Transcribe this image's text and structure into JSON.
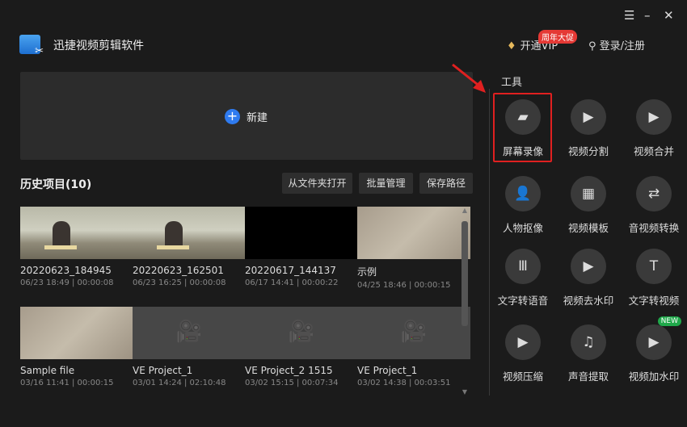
{
  "window": {
    "menu_icon": "☰",
    "min_icon": "–",
    "close_icon": "✕"
  },
  "app": {
    "title": "迅捷视频剪辑软件"
  },
  "header": {
    "vip_label": "开通VIP",
    "promo_badge": "周年大促",
    "login_label": "登录/注册"
  },
  "new_project": {
    "label": "新建",
    "icon": "+"
  },
  "history": {
    "title": "历史项目(10)",
    "buttons": [
      "从文件夹打开",
      "批量管理",
      "保存路径"
    ],
    "items": [
      {
        "name": "20220623_184945",
        "meta": "06/23 18:49 | 00:00:08",
        "thumb": "beach"
      },
      {
        "name": "20220623_162501",
        "meta": "06/23 16:25 | 00:00:08",
        "thumb": "beach"
      },
      {
        "name": "20220617_144137",
        "meta": "06/17 14:41 | 00:00:22",
        "thumb": "black"
      },
      {
        "name": "示例",
        "meta": "04/25 18:46 | 00:00:15",
        "thumb": "sand"
      },
      {
        "name": "Sample file",
        "meta": "03/16 11:41 | 00:00:15",
        "thumb": "sand"
      },
      {
        "name": "VE Project_1",
        "meta": "03/01 14:24 | 02:10:48",
        "thumb": "project"
      },
      {
        "name": "VE Project_2 1515",
        "meta": "03/02 15:15 | 00:07:34",
        "thumb": "project"
      },
      {
        "name": "VE Project_1",
        "meta": "03/02 14:38 | 00:03:51",
        "thumb": "project"
      }
    ]
  },
  "tools": {
    "title": "工具",
    "items": [
      {
        "label": "屏幕录像",
        "icon": "▰"
      },
      {
        "label": "视频分割",
        "icon": "▶"
      },
      {
        "label": "视频合并",
        "icon": "▶"
      },
      {
        "label": "人物抠像",
        "icon": "👤"
      },
      {
        "label": "视频模板",
        "icon": "▦"
      },
      {
        "label": "音视频转换",
        "icon": "⇄"
      },
      {
        "label": "文字转语音",
        "icon": "Ⅲ"
      },
      {
        "label": "视频去水印",
        "icon": "▶"
      },
      {
        "label": "文字转视频",
        "icon": "T"
      },
      {
        "label": "视频压缩",
        "icon": "▶"
      },
      {
        "label": "声音提取",
        "icon": "♫"
      },
      {
        "label": "视频加水印",
        "icon": "▶",
        "badge": "NEW"
      }
    ]
  },
  "colors": {
    "accent": "#2f7bf0",
    "highlight": "#e02020",
    "promo": "#e53935",
    "new_badge": "#1fa84a"
  }
}
